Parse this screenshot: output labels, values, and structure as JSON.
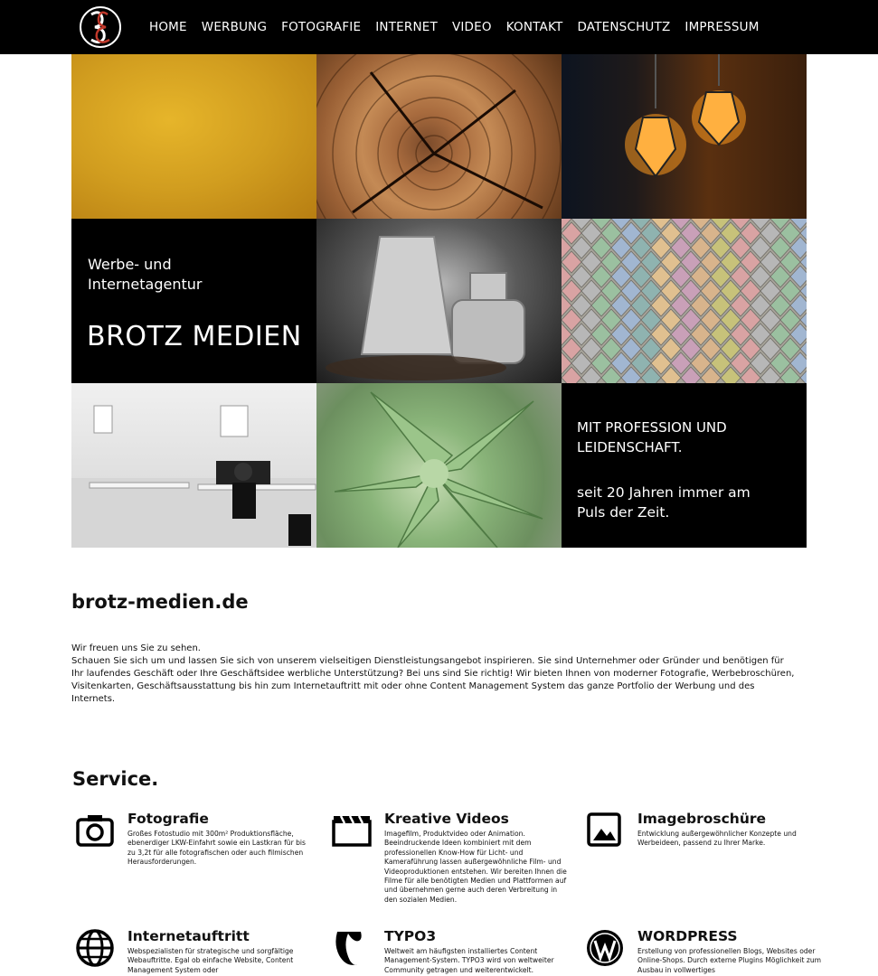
{
  "nav": {
    "items": [
      "HOME",
      "WERBUNG",
      "FOTOGRAFIE",
      "INTERNET",
      "VIDEO",
      "KONTAKT",
      "DATENSCHUTZ",
      "IMPRESSUM"
    ]
  },
  "hero": {
    "subtitle_line1": "Werbe- und",
    "subtitle_line2": "Internetagentur",
    "brand": "BROTZ MEDIEN",
    "claim_line1": "MIT PROFESSION UND",
    "claim_line2": "LEIDENSCHAFT.",
    "claim2_line1": "seit 20 Jahren immer am",
    "claim2_line2": "Puls der Zeit."
  },
  "content": {
    "title": "brotz-medien.de",
    "intro_line1": "Wir freuen uns Sie zu sehen.",
    "intro_line2": "Schauen Sie sich um und lassen Sie sich von unserem vielseitigen Dienstleistungsangebot inspirieren. Sie sind Unternehmer oder Gründer und benötigen für Ihr laufendes Geschäft oder Ihre Geschäftsidee werbliche Unterstützung? Bei uns sind Sie richtig! Wir bieten Ihnen von moderner Fotografie, Werbebroschüren, Visitenkarten, Geschäftsausstattung bis hin zum Internetauftritt mit oder ohne Content Management System das ganze Portfolio der Werbung und des Internets."
  },
  "service": {
    "title": "Service.",
    "items": [
      {
        "icon": "camera-icon",
        "title": "Fotografie",
        "text": "Großes Fotostudio mit 300m² Produktionsfläche, ebenerdiger LKW-Einfahrt sowie ein Lastkran für bis zu 3,2t für alle fotografischen oder auch filmischen Herausforderungen."
      },
      {
        "icon": "clapperboard-icon",
        "title": "Kreative Videos",
        "text": "Imagefilm, Produktvideo oder Animation. Beeindruckende Ideen kombiniert mit dem professionellen Know-How für Licht- und Kameraführung lassen außergewöhnliche Film- und Videoproduktionen entstehen. Wir bereiten Ihnen die Filme für alle benötigten Medien und Plattformen auf und übernehmen gerne auch deren Verbreitung in den sozialen Medien."
      },
      {
        "icon": "image-icon",
        "title": "Imagebroschüre",
        "text": "Entwicklung außergewöhnlicher Konzepte und Werbeideen, passend zu Ihrer Marke."
      },
      {
        "icon": "globe-icon",
        "title": "Internetauftritt",
        "text": "Webspezialisten für strategische und sorgfältige Webauftritte. Egal ob einfache Website, Content Management System oder"
      },
      {
        "icon": "typo3-icon",
        "title": "TYPO3",
        "text": "Weltweit am häufigsten installiertes Content Management-System. TYPO3 wird von weltweiter Community getragen und weiterentwickelt."
      },
      {
        "icon": "wordpress-icon",
        "title": "WORDPRESS",
        "text": "Erstellung von professionellen Blogs, Websites oder Online-Shops. Durch externe Plugins Möglichkeit zum Ausbau in vollwertiges"
      }
    ]
  }
}
